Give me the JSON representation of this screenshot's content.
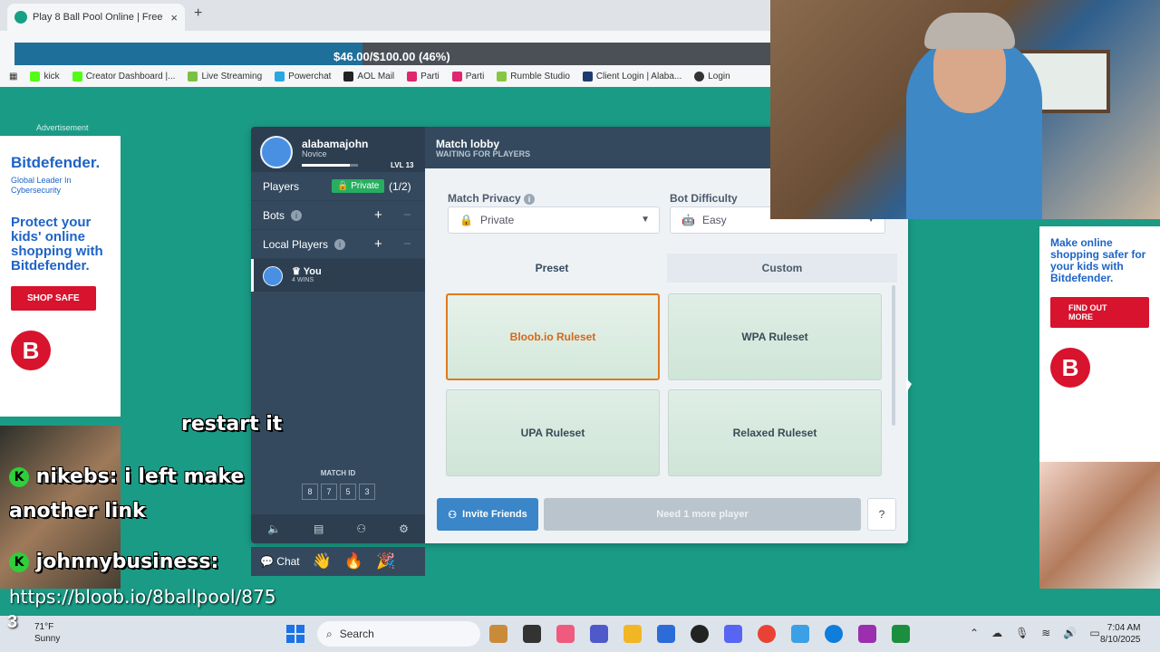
{
  "browser": {
    "tab_title": "Play 8 Ball Pool Online | Free M",
    "tab_close": "×",
    "new_tab": "+",
    "bookmarks": [
      "kick",
      "Creator Dashboard |...",
      "Live Streaming",
      "Powerchat",
      "AOL Mail",
      "Parti",
      "Parti",
      "Rumble Studio",
      "Client Login | Alaba...",
      "Login"
    ]
  },
  "goal": {
    "text": "$46.00/$100.00 (46%)",
    "progress": 0.46
  },
  "ads": {
    "label": "Advertisement",
    "left": {
      "brand": "Bitdefender.",
      "tagline": "Global Leader In Cybersecurity",
      "headline": "Protect your kids' online shopping with Bitdefender.",
      "cta": "SHOP SAFE",
      "logo": "B"
    },
    "right": {
      "headline": "Make online shopping safer for your kids with Bitdefender.",
      "cta": "FIND OUT MORE",
      "logo": "B"
    }
  },
  "profile": {
    "username": "alabamajohn",
    "rank": "Novice",
    "level": "LVL 13",
    "xp": 0.85
  },
  "sidebar": {
    "players_label": "Players",
    "private_tag": "Private",
    "players_count": "(1/2)",
    "bots_label": "Bots",
    "local_players_label": "Local Players",
    "info": "i",
    "plus": "+",
    "minus": "−",
    "you_name": "You",
    "you_wins": "4 WINS",
    "match_id_label": "MATCH ID",
    "match_id": [
      "8",
      "7",
      "5",
      "3"
    ]
  },
  "lobby": {
    "title": "Match lobby",
    "subtitle": "WAITING FOR PLAYERS",
    "privacy_label": "Match Privacy",
    "privacy_value": "Private",
    "bot_label": "Bot Difficulty",
    "bot_value": "Easy",
    "tab_preset": "Preset",
    "tab_custom": "Custom",
    "rulesets": [
      "Bloob.io Ruleset",
      "WPA Ruleset",
      "UPA Ruleset",
      "Relaxed Ruleset"
    ],
    "invite": "Invite Friends",
    "need_more": "Need 1 more player",
    "help": "?"
  },
  "chatbar": {
    "chat_label": "Chat",
    "emojis": [
      "👋",
      "🔥",
      "🎉"
    ]
  },
  "stream_chat": {
    "line1_text": "restart it",
    "line2_nick": "nikebs:",
    "line2_text": "i left make",
    "line3_text": "another link",
    "line4_nick": "johnnybusiness:",
    "url": "https://bloob.io/8ballpool/875"
  },
  "taskbar": {
    "number": "3",
    "temp": "71°F",
    "weather": "Sunny",
    "search": "Search",
    "time": "7:04 AM",
    "date": "8/10/2025"
  }
}
